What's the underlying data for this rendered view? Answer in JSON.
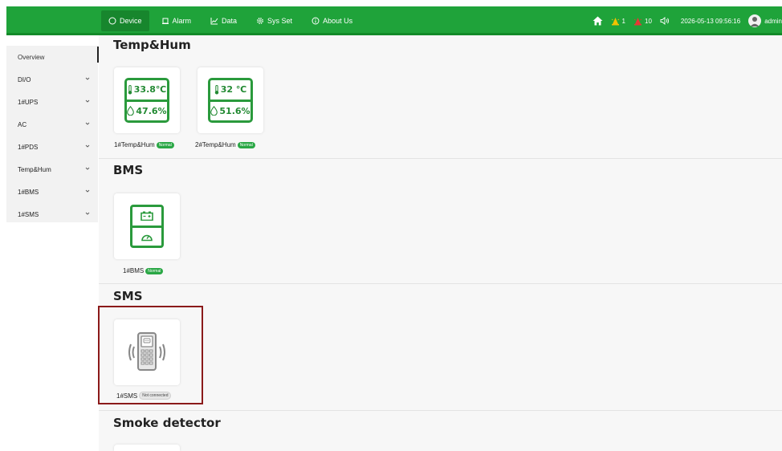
{
  "nav": {
    "items": [
      {
        "label": "Device",
        "icon": "device-icon",
        "active": true
      },
      {
        "label": "Alarm",
        "icon": "alarm-icon",
        "active": false
      },
      {
        "label": "Data",
        "icon": "chart-icon",
        "active": false
      },
      {
        "label": "Sys Set",
        "icon": "gear-icon",
        "active": false
      },
      {
        "label": "About Us",
        "icon": "info-icon",
        "active": false
      }
    ]
  },
  "toolbar": {
    "alarm_warning_count": "1",
    "alarm_critical_count": "10",
    "datetime": "2026-05-13 09:56:16",
    "username": "admin"
  },
  "sidebar": {
    "items": [
      {
        "label": "Overview"
      },
      {
        "label": "DI/O"
      },
      {
        "label": "1#UPS"
      },
      {
        "label": "AC"
      },
      {
        "label": "1#PDS"
      },
      {
        "label": "Temp&Hum"
      },
      {
        "label": "1#BMS"
      },
      {
        "label": "1#SMS"
      }
    ]
  },
  "sections": {
    "temphum": {
      "title": "Temp&Hum",
      "devices": [
        {
          "name": "1#Temp&Hum",
          "temp": "33.8℃",
          "hum": "47.6%",
          "status": "Normal"
        },
        {
          "name": "2#Temp&Hum",
          "temp": "32 ℃",
          "hum": "51.6%",
          "status": "Normal"
        }
      ]
    },
    "bms": {
      "title": "BMS",
      "devices": [
        {
          "name": "1#BMS",
          "status": "Normal"
        }
      ]
    },
    "sms": {
      "title": "SMS",
      "devices": [
        {
          "name": "1#SMS",
          "status": "Not connected"
        }
      ]
    },
    "smoke": {
      "title": "Smoke detector"
    }
  },
  "colors": {
    "brand_green": "#1fa33a",
    "tile_green": "#2a9a3c",
    "highlight": "#8b1a1a"
  }
}
